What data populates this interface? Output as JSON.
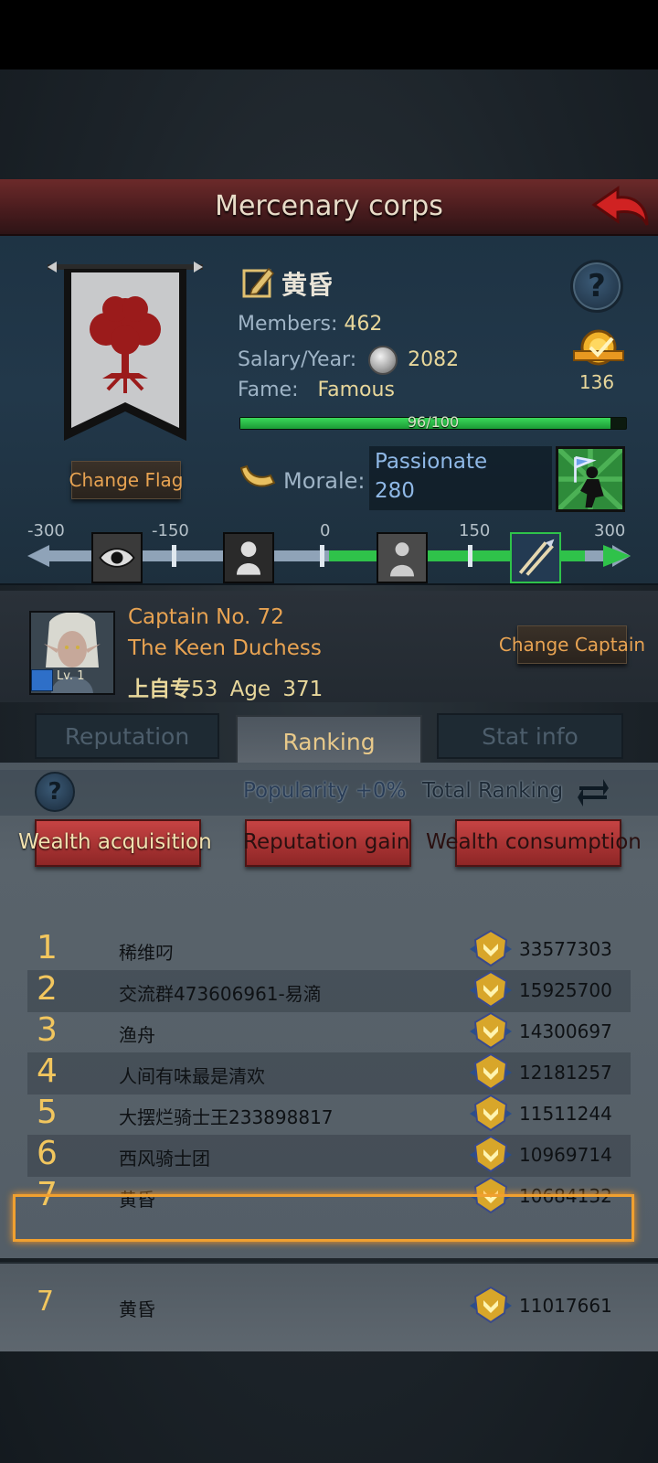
{
  "header": {
    "title": "Mercenary corps"
  },
  "corps": {
    "name": "黄昏",
    "members_label": "Members:",
    "members_value": "462",
    "salary_label": "Salary/Year:",
    "salary_value": "2082",
    "fame_label": "Fame:",
    "fame_value": "Famous",
    "fame_progress_text": "96/100",
    "fame_fraction": 0.96,
    "rank_count": "136",
    "change_flag": "Change Flag",
    "morale_label": "Morale:",
    "morale_state": "Passionate",
    "morale_value": "280"
  },
  "morale_scale": {
    "ticks": [
      "-300",
      "-150",
      "0",
      "150",
      "300"
    ],
    "current_value": 280
  },
  "captain": {
    "line1": "Captain No. 72",
    "line2": "The Keen Duchess",
    "name_cn": "上自专",
    "name_num": "53",
    "age_label": "Age",
    "age_value": "371",
    "level": "Lv. 1",
    "change_captain": "Change Captain"
  },
  "tabs": [
    {
      "label": "Reputation",
      "active": false
    },
    {
      "label": "Ranking",
      "active": true
    },
    {
      "label": "Stat info",
      "active": false
    }
  ],
  "ranking": {
    "popularity": "Popularity +0%",
    "total_ranking": "Total Ranking",
    "categories": [
      "Wealth acquisition",
      "Reputation gain",
      "Wealth consumption"
    ],
    "rows": [
      {
        "rank": "1",
        "name": "稀维叼",
        "score": "33577303"
      },
      {
        "rank": "2",
        "name": "交流群473606961-易滴",
        "score": "15925700"
      },
      {
        "rank": "3",
        "name": "渔舟",
        "score": "14300697"
      },
      {
        "rank": "4",
        "name": "人间有味最是清欢",
        "score": "12181257"
      },
      {
        "rank": "5",
        "name": "大摆烂骑士王233898817",
        "score": "11511244"
      },
      {
        "rank": "6",
        "name": "西风骑士团",
        "score": "10969714"
      },
      {
        "rank": "7",
        "name": "黄昏",
        "score": "10684132"
      }
    ],
    "mine": {
      "rank": "7",
      "name": "黄昏",
      "score": "11017661"
    }
  },
  "colors": {
    "accent_gold": "#f2c65e",
    "button_red": "#c64343",
    "fame_green": "#3ad85a",
    "header_red": "#6c2a2a"
  }
}
